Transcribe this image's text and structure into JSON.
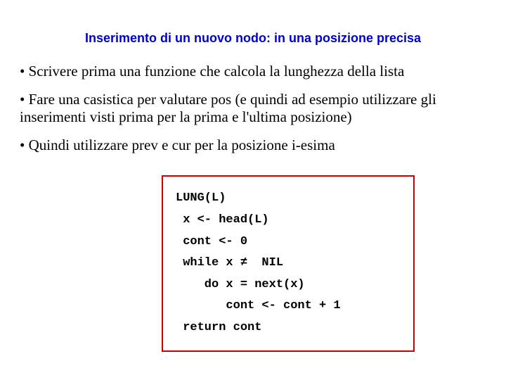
{
  "title": "Inserimento di un nuovo nodo: in una posizione precisa",
  "bullets": [
    "• Scrivere prima una funzione che calcola la lunghezza della lista",
    "• Fare una casistica per valutare pos (e quindi ad esempio utilizzare gli inserimenti visti prima per la prima e l'ultima posizione)",
    "• Quindi utilizzare prev e cur per la posizione i-esima"
  ],
  "code": {
    "l0": "LUNG(L)",
    "l1": " x <- head(L)",
    "l2": " cont <- 0",
    "l3": " while x ≠  NIL",
    "l4": "    do x = next(x)",
    "l5": "       cont <- cont + 1",
    "l6": " return cont"
  }
}
